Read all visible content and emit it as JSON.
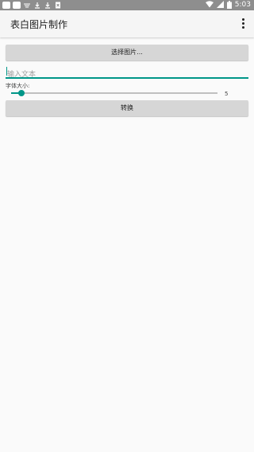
{
  "status_bar": {
    "left_icons": [
      "app-icon",
      "app-icon",
      "cast-icon",
      "download-icon",
      "download-icon",
      "notification-icon"
    ],
    "right_icons": [
      "wifi-icon",
      "signal-icon",
      "battery-icon"
    ],
    "time": "5:03"
  },
  "app_bar": {
    "title": "表白图片制作",
    "overflow_icon": "more-vert-icon"
  },
  "form": {
    "pick_image_label": "选择图片...",
    "text_input_placeholder": "输入文本",
    "text_input_value": "",
    "font_size_label": "字体大小:",
    "font_size_value": "5",
    "font_size_fraction": 0.05,
    "convert_label": "转换"
  },
  "colors": {
    "accent": "#009688",
    "status_bar": "#8e8e8e",
    "app_bar": "#f5f5f5",
    "button": "#d6d6d6",
    "background": "#fafafa"
  }
}
